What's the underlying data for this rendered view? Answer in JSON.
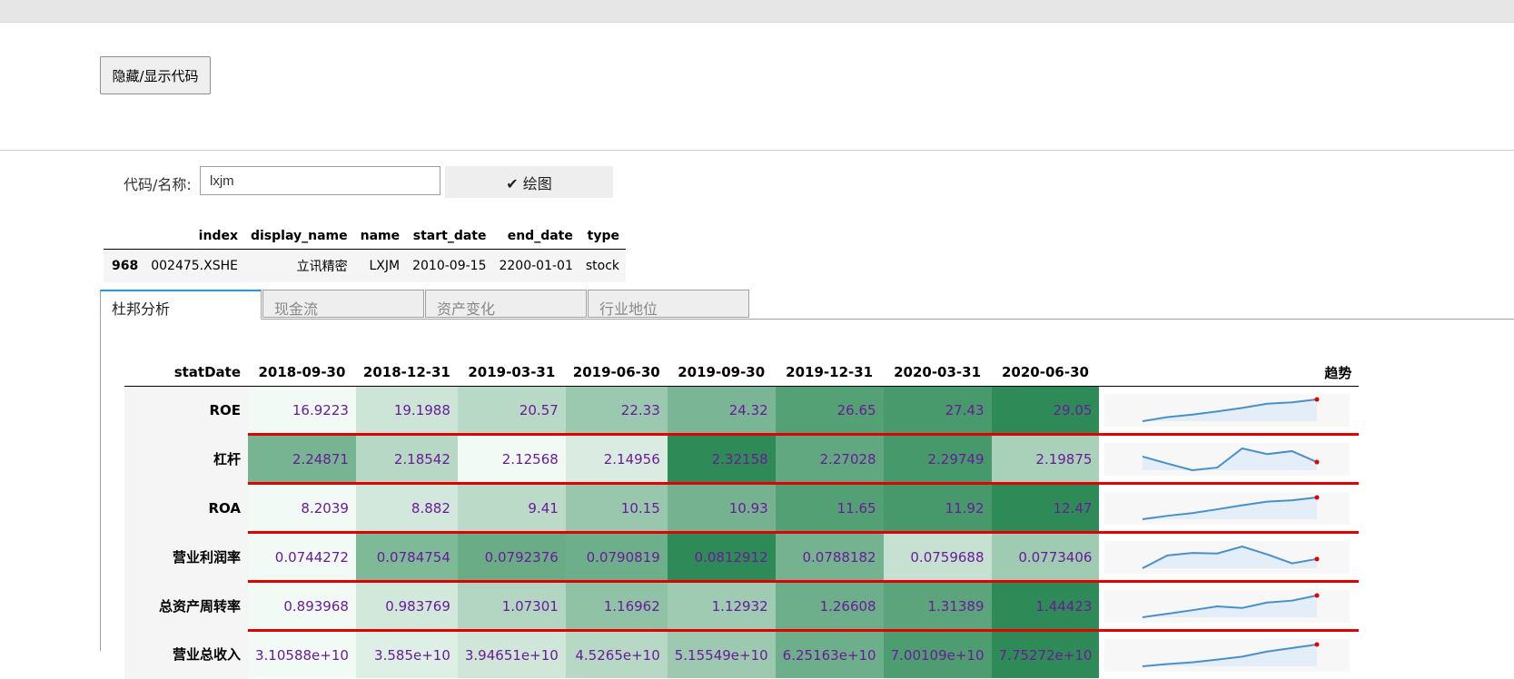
{
  "toolbar": {
    "toggle_label": "隐藏/显示代码"
  },
  "search": {
    "label": "代码/名称:",
    "value": "lxjm",
    "plot_label": "绘图"
  },
  "result_table": {
    "headers": [
      "index",
      "display_name",
      "name",
      "start_date",
      "end_date",
      "type"
    ],
    "row": {
      "idx": "968",
      "index": "002475.XSHE",
      "display_name": "立讯精密",
      "name": "LXJM",
      "start_date": "2010-09-15",
      "end_date": "2200-01-01",
      "type": "stock"
    }
  },
  "tabs": [
    {
      "label": "杜邦分析",
      "active": true
    },
    {
      "label": "现金流",
      "active": false
    },
    {
      "label": "资产变化",
      "active": false
    },
    {
      "label": "行业地位",
      "active": false
    }
  ],
  "dupont": {
    "index_header": "statDate",
    "trend_header": "趋势",
    "dates": [
      "2018-09-30",
      "2018-12-31",
      "2019-03-31",
      "2019-06-30",
      "2019-09-30",
      "2019-12-31",
      "2020-03-31",
      "2020-06-30"
    ],
    "rows": [
      {
        "label": "ROE",
        "values": [
          "16.9223",
          "19.1988",
          "20.57",
          "22.33",
          "24.32",
          "26.65",
          "27.43",
          "29.05"
        ],
        "numeric": [
          16.9223,
          19.1988,
          20.57,
          22.33,
          24.32,
          26.65,
          27.43,
          29.05
        ]
      },
      {
        "label": "杠杆",
        "values": [
          "2.24871",
          "2.18542",
          "2.12568",
          "2.14956",
          "2.32158",
          "2.27028",
          "2.29749",
          "2.19875"
        ],
        "numeric": [
          2.24871,
          2.18542,
          2.12568,
          2.14956,
          2.32158,
          2.27028,
          2.29749,
          2.19875
        ]
      },
      {
        "label": "ROA",
        "values": [
          "8.2039",
          "8.882",
          "9.41",
          "10.15",
          "10.93",
          "11.65",
          "11.92",
          "12.47"
        ],
        "numeric": [
          8.2039,
          8.882,
          9.41,
          10.15,
          10.93,
          11.65,
          11.92,
          12.47
        ]
      },
      {
        "label": "营业利润率",
        "values": [
          "0.0744272",
          "0.0784754",
          "0.0792376",
          "0.0790819",
          "0.0812912",
          "0.0788182",
          "0.0759688",
          "0.0773406"
        ],
        "numeric": [
          0.0744272,
          0.0784754,
          0.0792376,
          0.0790819,
          0.0812912,
          0.0788182,
          0.0759688,
          0.0773406
        ]
      },
      {
        "label": "总资产周转率",
        "values": [
          "0.893968",
          "0.983769",
          "1.07301",
          "1.16962",
          "1.12932",
          "1.26608",
          "1.31389",
          "1.44423"
        ],
        "numeric": [
          0.893968,
          0.983769,
          1.07301,
          1.16962,
          1.12932,
          1.26608,
          1.31389,
          1.44423
        ]
      },
      {
        "label": "营业总收入",
        "values": [
          "3.10588e+10",
          "3.585e+10",
          "3.94651e+10",
          "4.5265e+10",
          "5.15549e+10",
          "6.25163e+10",
          "7.00109e+10",
          "7.75272e+10"
        ],
        "numeric": [
          31058800000.0,
          35850000000.0,
          39465100000.0,
          45265000000.0,
          51554900000.0,
          62516300000.0,
          70010900000.0,
          77527200000.0
        ]
      }
    ]
  },
  "colors": {
    "heat_low": "#f2faf5",
    "heat_high": "#2e8b57",
    "value_text": "#6a1b9a",
    "separator": "#e00000",
    "spark_line": "#4a90c8",
    "spark_fill": "#e3eef8",
    "spark_dot": "#e00000",
    "tab_active_border": "#2196f3"
  }
}
